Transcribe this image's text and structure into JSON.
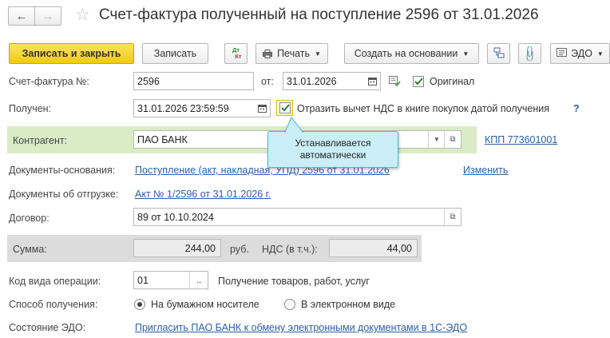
{
  "title": "Счет-фактура полученный на поступление 2596 от 31.01.2026",
  "toolbar": {
    "save_close": "Записать и закрыть",
    "save": "Записать",
    "dtkt_top": "Дт",
    "dtkt_bottom": "Кт",
    "print": "Печать",
    "create_based": "Создать на основании",
    "edo": "ЭДО"
  },
  "form": {
    "invoice_label": "Счет-фактура №:",
    "invoice_number": "2596",
    "from_label": "от:",
    "invoice_date": "31.01.2026",
    "original_label": "Оригинал",
    "received_label": "Получен:",
    "received_value": "31.01.2026 23:59:59",
    "vat_label": "Отразить вычет НДС в книге покупок датой получения",
    "help": "?",
    "counterparty_label": "Контрагент:",
    "counterparty_value": "ПАО БАНК",
    "kpp_link": "КПП 773601001",
    "tooltip": "Устанавливается автоматически",
    "basis_label": "Документы-основания:",
    "basis_link": "Поступление (акт, накладная, УПД) 2596 от 31.01.2026",
    "change_link": "Изменить",
    "shipment_label": "Документы об отгрузке:",
    "shipment_link": "Акт № 1/2596 от 31.01.2026 г.",
    "contract_label": "Договор:",
    "contract_value": "89 от 10.10.2024",
    "sum_label": "Сумма:",
    "sum_value": "244,00",
    "currency": "руб.",
    "vat_sum_label": "НДС (в т.ч.):",
    "vat_sum_value": "44,00",
    "opcode_label": "Код вида операции:",
    "opcode_value": "01",
    "opcode_desc": "Получение товаров, работ, услуг",
    "method_label": "Способ получения:",
    "method_paper": "На бумажном носителе",
    "method_electronic": "В электронном виде",
    "edo_state_label": "Состояние ЭДО:",
    "edo_state_link": "Пригласить ПАО БАНК к обмену электронными документами в 1С-ЭДО"
  },
  "colors": {
    "primary_button": "#f5d21f",
    "counterparty_highlight": "#d9ecc6",
    "sum_row_bg": "#dcdcdc",
    "tooltip_bg": "#c9eef7",
    "tooltip_border": "#53b6d2",
    "link": "#2a5fa7"
  }
}
